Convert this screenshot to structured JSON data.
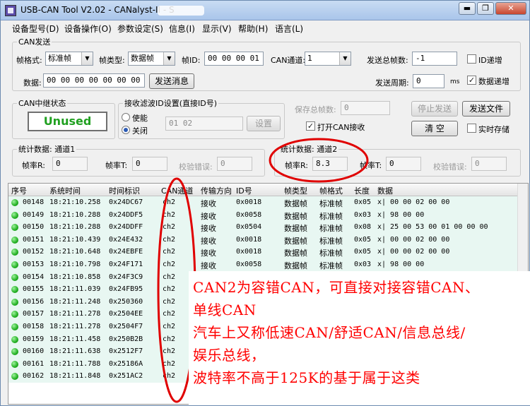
{
  "window": {
    "title": "USB-CAN Tool V2.02 - CANalyst-II - S",
    "controls": [
      "▬",
      "❐",
      "✕"
    ]
  },
  "menu": [
    "设备型号(D)",
    "设备操作(O)",
    "参数设定(S)",
    "信息(I)",
    "显示(V)",
    "帮助(H)",
    "语言(L)"
  ],
  "can_send": {
    "group_label": "CAN发送",
    "frame_format_label": "帧格式:",
    "frame_format_value": "标准帧",
    "frame_type_label": "帧类型:",
    "frame_type_value": "数据帧",
    "frame_id_label": "帧ID:",
    "frame_id_value": "00 00 00 01",
    "channel_label": "CAN通道:",
    "channel_value": "1",
    "total_frames_label": "发送总帧数:",
    "total_frames_value": "-1",
    "id_increment_label": "ID递增",
    "data_label": "数据:",
    "data_value": "00 00 00 00 00 00 00 00",
    "send_button": "发送消息",
    "period_label": "发送周期:",
    "period_value": "0",
    "period_unit": "ms",
    "data_increment_label": "数据递增"
  },
  "relay": {
    "group_label": "CAN中继状态",
    "status": "Unused"
  },
  "filter": {
    "group_label": "接收滤波ID设置(直接ID号)",
    "enable_label": "使能",
    "disable_label": "关闭",
    "ids_value": "01 02",
    "set_button": "设置"
  },
  "save_controls": {
    "total_frames_label": "保存总帧数:",
    "total_frames_value": "0",
    "open_can_rx_label": "打开CAN接收",
    "stop_send_button": "停止发送",
    "send_file_button": "发送文件",
    "clear_button": "清 空",
    "realtime_save_label": "实时存储"
  },
  "stats1": {
    "group_label": "统计数据: 通道1",
    "rx_rate_label": "帧率R:",
    "rx_rate_value": "0",
    "tx_rate_label": "帧率T:",
    "tx_rate_value": "0",
    "error_label": "校验错误:",
    "error_value": "0"
  },
  "stats2": {
    "group_label": "统计数据: 通道2",
    "rx_rate_label": "帧率R:",
    "rx_rate_value": "8.3",
    "tx_rate_label": "帧率T:",
    "tx_rate_value": "0",
    "error_label": "校验错误:",
    "error_value": "0"
  },
  "table": {
    "columns": [
      "序号",
      "系统时间",
      "时间标识",
      "CAN通道",
      "传输方向",
      "ID号",
      "帧类型",
      "帧格式",
      "长度",
      "数据"
    ],
    "rows": [
      [
        "00148",
        "18:21:10.258",
        "0x24DC67",
        "ch2",
        "接收",
        "0x0018",
        "数据帧",
        "标准帧",
        "0x05",
        "x| 00 00 02 00 00"
      ],
      [
        "00149",
        "18:21:10.288",
        "0x24DDF5",
        "ch2",
        "接收",
        "0x0058",
        "数据帧",
        "标准帧",
        "0x03",
        "x| 98 00 00"
      ],
      [
        "00150",
        "18:21:10.288",
        "0x24DDFF",
        "ch2",
        "接收",
        "0x0504",
        "数据帧",
        "标准帧",
        "0x08",
        "x| 25 00 53 00 01 00 00 00"
      ],
      [
        "00151",
        "18:21:10.439",
        "0x24E432",
        "ch2",
        "接收",
        "0x0018",
        "数据帧",
        "标准帧",
        "0x05",
        "x| 00 00 02 00 00"
      ],
      [
        "00152",
        "18:21:10.648",
        "0x24EBFE",
        "ch2",
        "接收",
        "0x0018",
        "数据帧",
        "标准帧",
        "0x05",
        "x| 00 00 02 00 00"
      ],
      [
        "00153",
        "18:21:10.798",
        "0x24F171",
        "ch2",
        "接收",
        "0x0058",
        "数据帧",
        "标准帧",
        "0x03",
        "x| 98 00 00"
      ],
      [
        "00154",
        "18:21:10.858",
        "0x24F3C9",
        "ch2",
        "",
        "",
        "",
        "",
        "",
        ""
      ],
      [
        "00155",
        "18:21:11.039",
        "0x24FB95",
        "ch2",
        "",
        "",
        "",
        "",
        "",
        ""
      ],
      [
        "00156",
        "18:21:11.248",
        "0x250360",
        "ch2",
        "",
        "",
        "",
        "",
        "",
        ""
      ],
      [
        "00157",
        "18:21:11.278",
        "0x2504EE",
        "ch2",
        "",
        "",
        "",
        "",
        "",
        ""
      ],
      [
        "00158",
        "18:21:11.278",
        "0x2504F7",
        "ch2",
        "",
        "",
        "",
        "",
        "",
        ""
      ],
      [
        "00159",
        "18:21:11.458",
        "0x250B2B",
        "ch2",
        "",
        "",
        "",
        "",
        "",
        ""
      ],
      [
        "00160",
        "18:21:11.638",
        "0x2512F7",
        "ch2",
        "",
        "",
        "",
        "",
        "",
        ""
      ],
      [
        "00161",
        "18:21:11.788",
        "0x25186A",
        "ch2",
        "",
        "",
        "",
        "",
        "",
        ""
      ],
      [
        "00162",
        "18:21:11.848",
        "0x251AC2",
        "ch2",
        "",
        "",
        "",
        "",
        "",
        ""
      ]
    ]
  },
  "annotation": {
    "lines": [
      "CAN2为容错CAN，可直接对接容错CAN、",
      "单线CAN",
      "汽车上又称低速CAN/舒适CAN/信息总线/",
      "娱乐总线，",
      "波特率不高于125K的基于属于这类"
    ],
    "color": "#ff0000"
  }
}
